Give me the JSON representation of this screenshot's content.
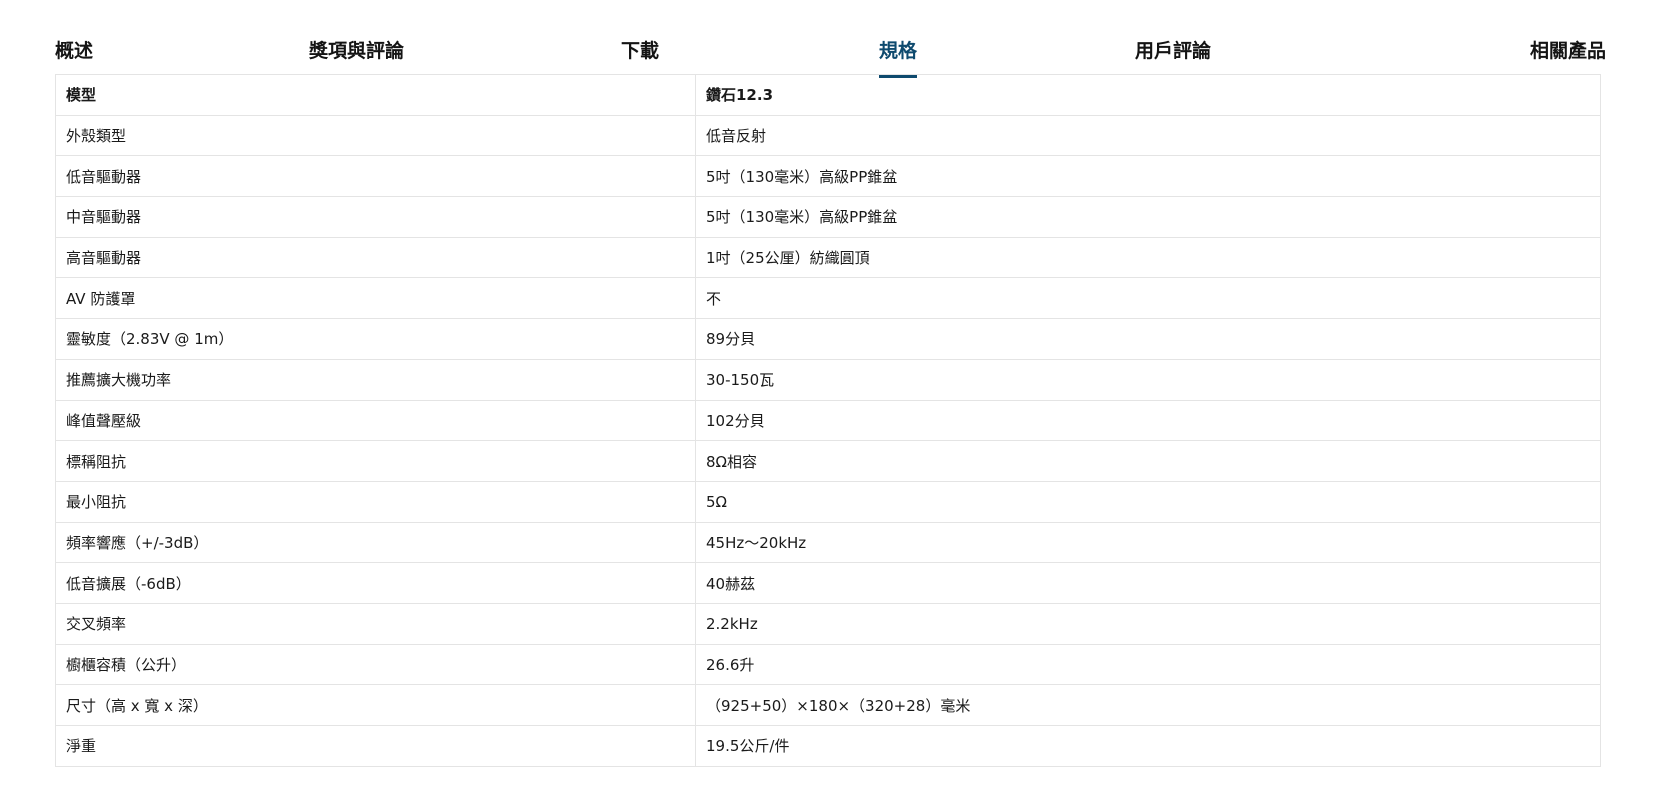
{
  "tabs": [
    {
      "label": "概述"
    },
    {
      "label": "獎項與評論"
    },
    {
      "label": "下載"
    },
    {
      "label": "規格",
      "active": true
    },
    {
      "label": "用戶評論"
    },
    {
      "label": "相關產品"
    }
  ],
  "colors": {
    "accent": "#0e4a6e",
    "border": "#e4e4e4"
  },
  "spec_table": {
    "header": {
      "key": "模型",
      "value": "鑽石12.3"
    },
    "rows": [
      {
        "key": "外殼類型",
        "value": "低音反射"
      },
      {
        "key": "低音驅動器",
        "value": "5吋（130毫米）高級PP錐盆"
      },
      {
        "key": "中音驅動器",
        "value": "5吋（130毫米）高級PP錐盆"
      },
      {
        "key": "高音驅動器",
        "value": "1吋（25公厘）紡織圓頂"
      },
      {
        "key": "AV 防護罩",
        "value": "不"
      },
      {
        "key": "靈敏度（2.83V @ 1m）",
        "value": "89分貝"
      },
      {
        "key": "推薦擴大機功率",
        "value": "30-150瓦"
      },
      {
        "key": "峰值聲壓級",
        "value": "102分貝"
      },
      {
        "key": "標稱阻抗",
        "value": "8Ω相容"
      },
      {
        "key": "最小阻抗",
        "value": "5Ω"
      },
      {
        "key": "頻率響應（+/-3dB）",
        "value": "45Hz～20kHz"
      },
      {
        "key": "低音擴展（-6dB）",
        "value": "40赫茲"
      },
      {
        "key": "交叉頻率",
        "value": "2.2kHz"
      },
      {
        "key": "櫥櫃容積（公升）",
        "value": "26.6升"
      },
      {
        "key": "尺寸（高 x 寬 x 深）",
        "value": "（925+50）×180×（320+28）毫米"
      },
      {
        "key": "淨重",
        "value": "19.5公斤/件"
      }
    ]
  }
}
